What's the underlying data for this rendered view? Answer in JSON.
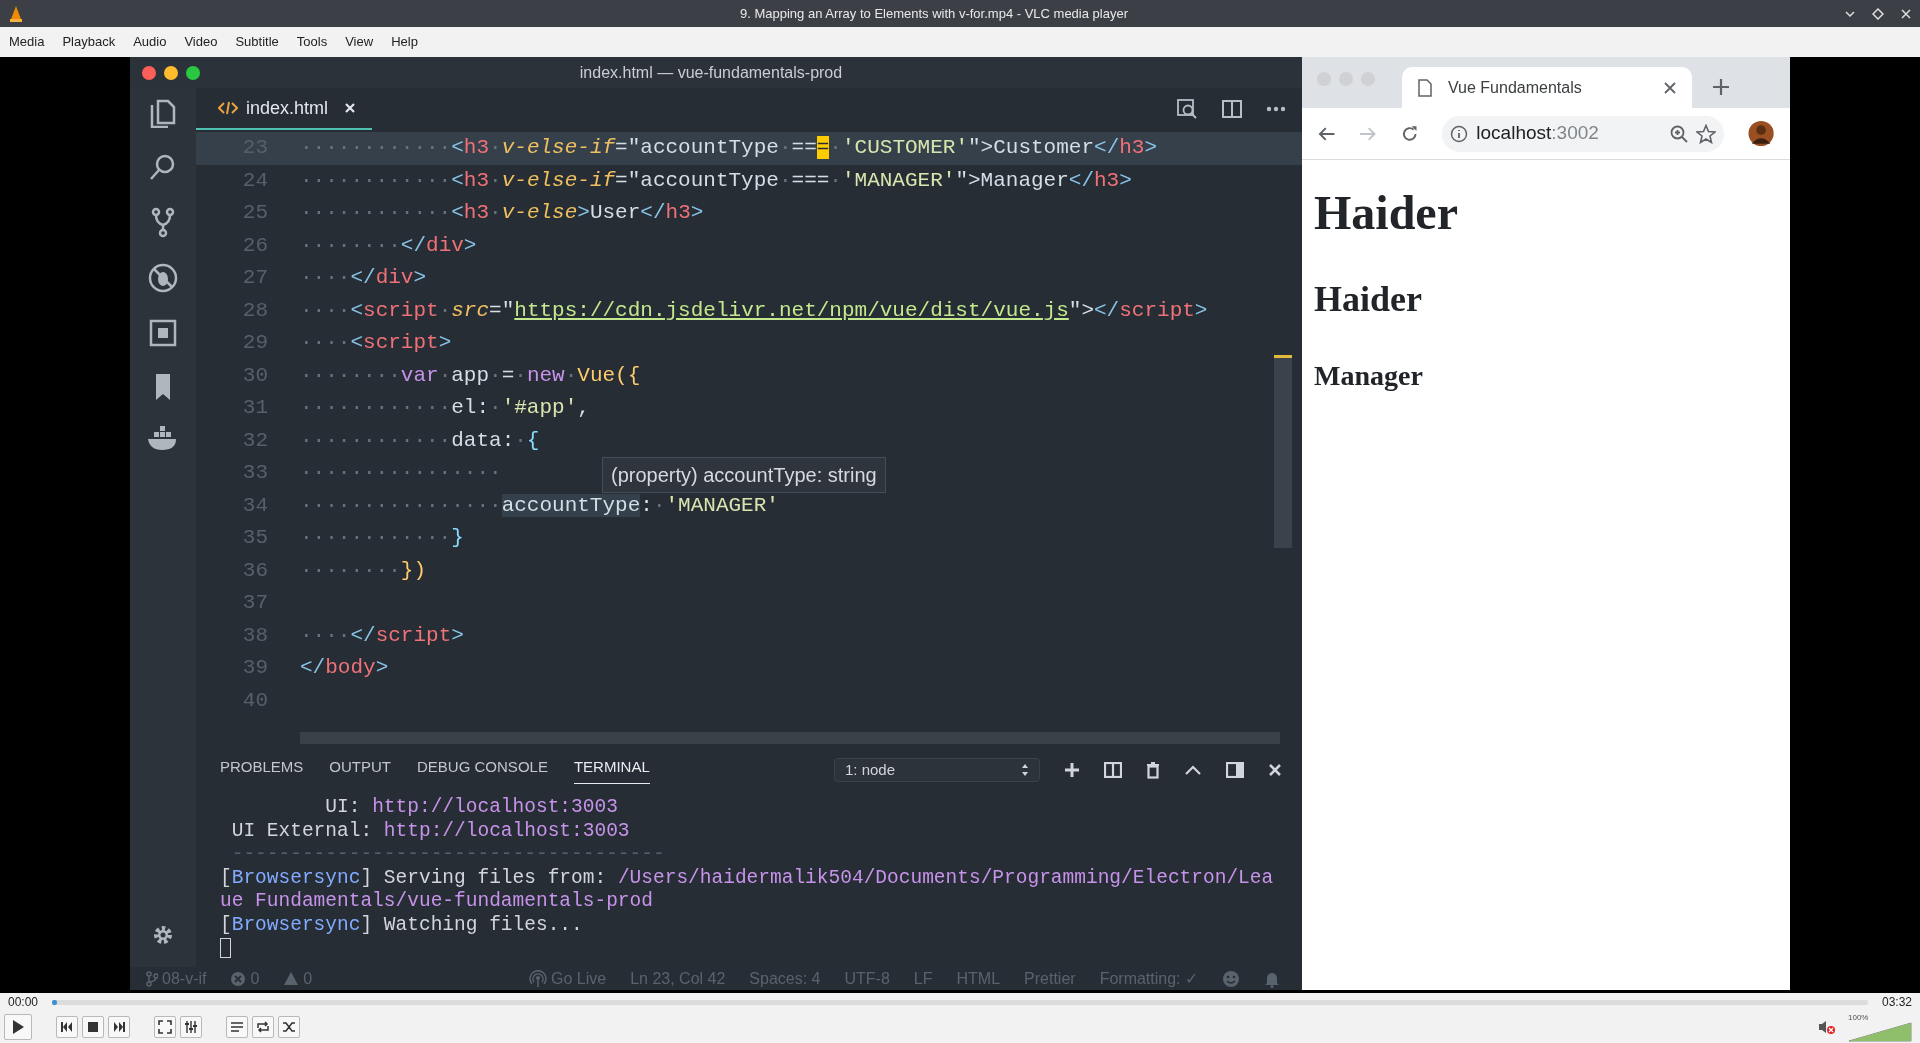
{
  "window": {
    "title": "9. Mapping an Array to Elements with v-for.mp4 - VLC media player"
  },
  "menu": [
    "Media",
    "Playback",
    "Audio",
    "Video",
    "Subtitle",
    "Tools",
    "View",
    "Help"
  ],
  "editor": {
    "title": "index.html — vue-fundamentals-prod",
    "tab": {
      "label": "index.html"
    },
    "lines": [
      {
        "number": "23",
        "current": true,
        "tokens": [
          {
            "kind": "ws",
            "text": "············"
          },
          {
            "kind": "punct",
            "text": "<"
          },
          {
            "kind": "tag",
            "text": "h3"
          },
          {
            "kind": "ws",
            "text": "·"
          },
          {
            "kind": "attr",
            "text": "v-else-if"
          },
          {
            "kind": "plain",
            "text": "=\"accountType"
          },
          {
            "kind": "ws",
            "text": "·"
          },
          {
            "kind": "plain",
            "text": "=="
          },
          {
            "kind": "cursor",
            "text": "="
          },
          {
            "kind": "ws",
            "text": "·"
          },
          {
            "kind": "string",
            "text": "'CUSTOMER'"
          },
          {
            "kind": "plain",
            "text": "\">Customer"
          },
          {
            "kind": "punct",
            "text": "</"
          },
          {
            "kind": "tag",
            "text": "h3"
          },
          {
            "kind": "punct",
            "text": ">"
          }
        ]
      },
      {
        "number": "24",
        "current": false,
        "tokens": [
          {
            "kind": "ws",
            "text": "············"
          },
          {
            "kind": "punct",
            "text": "<"
          },
          {
            "kind": "tag",
            "text": "h3"
          },
          {
            "kind": "ws",
            "text": "·"
          },
          {
            "kind": "attr",
            "text": "v-else-if"
          },
          {
            "kind": "plain",
            "text": "=\"accountType"
          },
          {
            "kind": "ws",
            "text": "·"
          },
          {
            "kind": "plain",
            "text": "==="
          },
          {
            "kind": "ws",
            "text": "·"
          },
          {
            "kind": "string",
            "text": "'MANAGER'"
          },
          {
            "kind": "plain",
            "text": "\">Manager"
          },
          {
            "kind": "punct",
            "text": "</"
          },
          {
            "kind": "tag",
            "text": "h3"
          },
          {
            "kind": "punct",
            "text": ">"
          }
        ]
      },
      {
        "number": "25",
        "current": false,
        "tokens": [
          {
            "kind": "ws",
            "text": "············"
          },
          {
            "kind": "punct",
            "text": "<"
          },
          {
            "kind": "tag",
            "text": "h3"
          },
          {
            "kind": "ws",
            "text": "·"
          },
          {
            "kind": "attr",
            "text": "v-else"
          },
          {
            "kind": "punct",
            "text": ">"
          },
          {
            "kind": "plain",
            "text": "User"
          },
          {
            "kind": "punct",
            "text": "</"
          },
          {
            "kind": "tag",
            "text": "h3"
          },
          {
            "kind": "punct",
            "text": ">"
          }
        ]
      },
      {
        "number": "26",
        "current": false,
        "tokens": [
          {
            "kind": "ws",
            "text": "········"
          },
          {
            "kind": "punct",
            "text": "</"
          },
          {
            "kind": "tag",
            "text": "div"
          },
          {
            "kind": "punct",
            "text": ">"
          }
        ]
      },
      {
        "number": "27",
        "current": false,
        "tokens": [
          {
            "kind": "ws",
            "text": "····"
          },
          {
            "kind": "punct",
            "text": "</"
          },
          {
            "kind": "tag",
            "text": "div"
          },
          {
            "kind": "punct",
            "text": ">"
          }
        ]
      },
      {
        "number": "28",
        "current": false,
        "tokens": [
          {
            "kind": "ws",
            "text": "····"
          },
          {
            "kind": "punct",
            "text": "<"
          },
          {
            "kind": "tag",
            "text": "script"
          },
          {
            "kind": "ws",
            "text": "·"
          },
          {
            "kind": "attr",
            "text": "src"
          },
          {
            "kind": "plain",
            "text": "=\""
          },
          {
            "kind": "url",
            "text": "https://cdn.jsdelivr.net/npm/vue/dist/vue.js"
          },
          {
            "kind": "plain",
            "text": "\">"
          },
          {
            "kind": "punct",
            "text": "</"
          },
          {
            "kind": "tag",
            "text": "script"
          },
          {
            "kind": "punct",
            "text": ">"
          }
        ]
      },
      {
        "number": "29",
        "current": false,
        "tokens": [
          {
            "kind": "ws",
            "text": "····"
          },
          {
            "kind": "punct",
            "text": "<"
          },
          {
            "kind": "tag",
            "text": "script"
          },
          {
            "kind": "punct",
            "text": ">"
          }
        ]
      },
      {
        "number": "30",
        "current": false,
        "tokens": [
          {
            "kind": "ws",
            "text": "········"
          },
          {
            "kind": "keyword",
            "text": "var"
          },
          {
            "kind": "ws",
            "text": "·"
          },
          {
            "kind": "plain",
            "text": "app"
          },
          {
            "kind": "ws",
            "text": "·"
          },
          {
            "kind": "plain",
            "text": "="
          },
          {
            "kind": "ws",
            "text": "·"
          },
          {
            "kind": "keyword",
            "text": "new"
          },
          {
            "kind": "ws",
            "text": "·"
          },
          {
            "kind": "class",
            "text": "Vue({"
          }
        ]
      },
      {
        "number": "31",
        "current": false,
        "tokens": [
          {
            "kind": "ws",
            "text": "············"
          },
          {
            "kind": "plain",
            "text": "el:"
          },
          {
            "kind": "ws",
            "text": "·"
          },
          {
            "kind": "string",
            "text": "'#app'"
          },
          {
            "kind": "plain",
            "text": ","
          }
        ]
      },
      {
        "number": "32",
        "current": false,
        "tokens": [
          {
            "kind": "ws",
            "text": "············"
          },
          {
            "kind": "plain",
            "text": "data:"
          },
          {
            "kind": "ws",
            "text": "·"
          },
          {
            "kind": "brace",
            "text": "{"
          }
        ]
      },
      {
        "number": "33",
        "current": false,
        "tokens": [
          {
            "kind": "ws",
            "text": "················"
          }
        ]
      },
      {
        "number": "34",
        "current": false,
        "tokens": [
          {
            "kind": "ws",
            "text": "················"
          },
          {
            "kind": "symbol",
            "text": "accountType"
          },
          {
            "kind": "plain",
            "text": ":"
          },
          {
            "kind": "ws",
            "text": "·"
          },
          {
            "kind": "string",
            "text": "'MANAGER'"
          }
        ]
      },
      {
        "number": "35",
        "current": false,
        "tokens": [
          {
            "kind": "ws",
            "text": "············"
          },
          {
            "kind": "brace",
            "text": "}"
          }
        ]
      },
      {
        "number": "36",
        "current": false,
        "tokens": [
          {
            "kind": "ws",
            "text": "········"
          },
          {
            "kind": "class",
            "text": "})"
          }
        ]
      },
      {
        "number": "37",
        "current": false
      },
      {
        "number": "38",
        "current": false,
        "tokens": [
          {
            "kind": "ws",
            "text": "····"
          },
          {
            "kind": "punct",
            "text": "</"
          },
          {
            "kind": "tag",
            "text": "script"
          },
          {
            "kind": "punct",
            "text": ">"
          }
        ]
      },
      {
        "number": "39",
        "current": false,
        "tokens": [
          {
            "kind": "punct",
            "text": "</"
          },
          {
            "kind": "tag",
            "text": "body"
          },
          {
            "kind": "punct",
            "text": ">"
          }
        ]
      },
      {
        "number": "40",
        "current": false
      }
    ],
    "tooltip": "(property) accountType: string"
  },
  "panel": {
    "tabs": [
      {
        "label": "PROBLEMS",
        "selected": false
      },
      {
        "label": "OUTPUT",
        "selected": false
      },
      {
        "label": "DEBUG CONSOLE",
        "selected": false
      },
      {
        "label": "TERMINAL",
        "selected": true
      }
    ],
    "terminal_select": "1: node",
    "lines": [
      {
        "tokens": [
          {
            "kind": "plain",
            "text": "         UI: "
          },
          {
            "kind": "link",
            "text": "http://localhost:3003"
          }
        ]
      },
      {
        "tokens": [
          {
            "kind": "plain",
            "text": " UI External: "
          },
          {
            "kind": "link",
            "text": "http://localhost:3003"
          }
        ]
      },
      {
        "tokens": [
          {
            "kind": "rule",
            "text": " -------------------------------------"
          }
        ]
      },
      {
        "tokens": [
          {
            "kind": "plain",
            "text": "["
          },
          {
            "kind": "label",
            "text": "Browsersync"
          },
          {
            "kind": "plain",
            "text": "] Serving files from: "
          },
          {
            "kind": "link",
            "text": "/Users/haidermalik504/Documents/Programming/Electron/Lea"
          }
        ]
      },
      {
        "tokens": [
          {
            "kind": "link",
            "text": "ue Fundamentals/vue-fundamentals-prod"
          }
        ]
      },
      {
        "tokens": [
          {
            "kind": "plain",
            "text": "["
          },
          {
            "kind": "label",
            "text": "Browsersync"
          },
          {
            "kind": "plain",
            "text": "] Watching files..."
          }
        ]
      }
    ]
  },
  "status_bar": [
    {
      "kind": "branch",
      "text": "08-v-if"
    },
    {
      "kind": "errors",
      "text": "0"
    },
    {
      "kind": "warnings",
      "text": "0"
    },
    {
      "kind": "live",
      "text": "Go Live"
    },
    {
      "kind": "text",
      "text": "Ln 23, Col 42"
    },
    {
      "kind": "text",
      "text": "Spaces: 4"
    },
    {
      "kind": "text",
      "text": "UTF-8"
    },
    {
      "kind": "text",
      "text": "LF"
    },
    {
      "kind": "text",
      "text": "HTML"
    },
    {
      "kind": "text",
      "text": "Prettier"
    },
    {
      "kind": "text",
      "text": "Formatting: ✓"
    }
  ],
  "browser": {
    "tab_title": "Vue Fundamentals",
    "address": {
      "host": "localhost",
      "port": ":3002"
    },
    "headings": [
      {
        "kind": "h1",
        "text": "Haider"
      },
      {
        "kind": "h2",
        "text": "Haider"
      },
      {
        "kind": "h3",
        "text": "Manager"
      }
    ]
  },
  "player": {
    "elapsed": "00:00",
    "duration": "03:32",
    "progress": {
      "level": 0.003
    },
    "volume": {
      "level": 1,
      "reading": "100%",
      "muted": true
    }
  }
}
